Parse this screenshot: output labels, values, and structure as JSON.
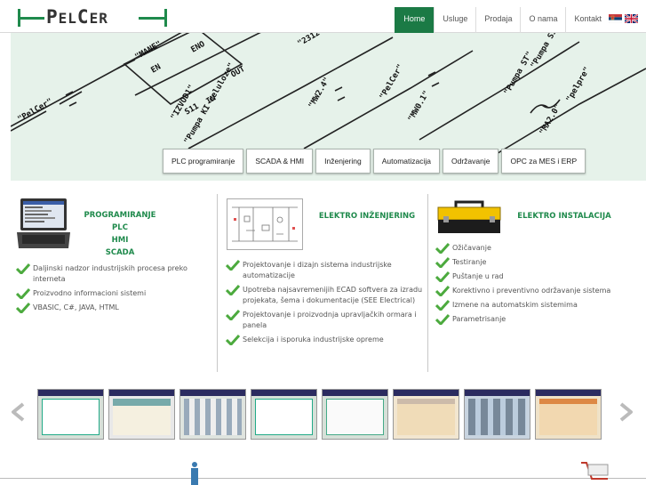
{
  "header": {
    "logo_text": "PELCER",
    "nav": [
      {
        "label": "Home"
      },
      {
        "label": "Usluge"
      },
      {
        "label": "Prodaja"
      },
      {
        "label": "O nama"
      },
      {
        "label": "Kontakt"
      }
    ],
    "flags": [
      "serbian-flag-icon",
      "uk-flag-icon"
    ]
  },
  "banner": {
    "diagram_labels": [
      "\"PelCer\"",
      "\"Pumpa KI celulozе\"",
      "\"IZVOD1\"",
      "\"MANE\"",
      "\"MW2.4\"",
      "\"PelCer\"",
      "\"MW0.1\"",
      "\"MA2.0\"",
      "\"pelpre\"",
      "\"Pumpa ST\"",
      "\"KUL\"",
      "EN",
      "ENO",
      "IN",
      "OUT",
      "S11",
      "\"2312\"",
      "\"Pumpa S1\""
    ],
    "services": [
      {
        "label": "PLC programiranje"
      },
      {
        "label": "SCADA & HMI"
      },
      {
        "label": "Inženjering"
      },
      {
        "label": "Automatizacija"
      },
      {
        "label": "Održavanje"
      },
      {
        "label": "OPC za MES i ERP"
      }
    ]
  },
  "columns": [
    {
      "title_lines": [
        "PROGRAMIRANJE",
        "PLC",
        "HMI",
        "SCADA"
      ],
      "image": "laptop-image",
      "items": [
        "Daljinski nadzor industrijskih procesa preko interneta",
        "Proizvodno informacioni sistemi",
        "VBASIC, C#, JAVA, HTML"
      ]
    },
    {
      "title_lines": [
        "ELEKTRO INŽENJERING"
      ],
      "image": "schematic-image",
      "items": [
        "Projektovanje i dizajn sistema industrijske automatizacije",
        "Upotreba najsavremenijih ECAD softvera za izradu projekata, šema i dokumentacije (SEE Electrical)",
        "Projektovanje i proizvodnja upravljačkih ormara i panela",
        "Selekcija i isporuka industrijske opreme"
      ]
    },
    {
      "title_lines": [
        "ELEKTRO INSTALACIJA"
      ],
      "image": "toolbox-image",
      "items": [
        "Ožičavanje",
        "Testiranje",
        "Puštanje u rad",
        "Korektivno i preventivno održavanje sistema",
        "Izmene na automatskim sistemima",
        "Parametrisanje"
      ]
    }
  ],
  "carousel": {
    "prev": "chevron-left-icon",
    "next": "chevron-right-icon",
    "thumb_count": 8
  },
  "colors": {
    "brand_green": "#1f8a4c",
    "nav_active": "#1b7a45",
    "banner_bg": "#e6f2ea"
  }
}
